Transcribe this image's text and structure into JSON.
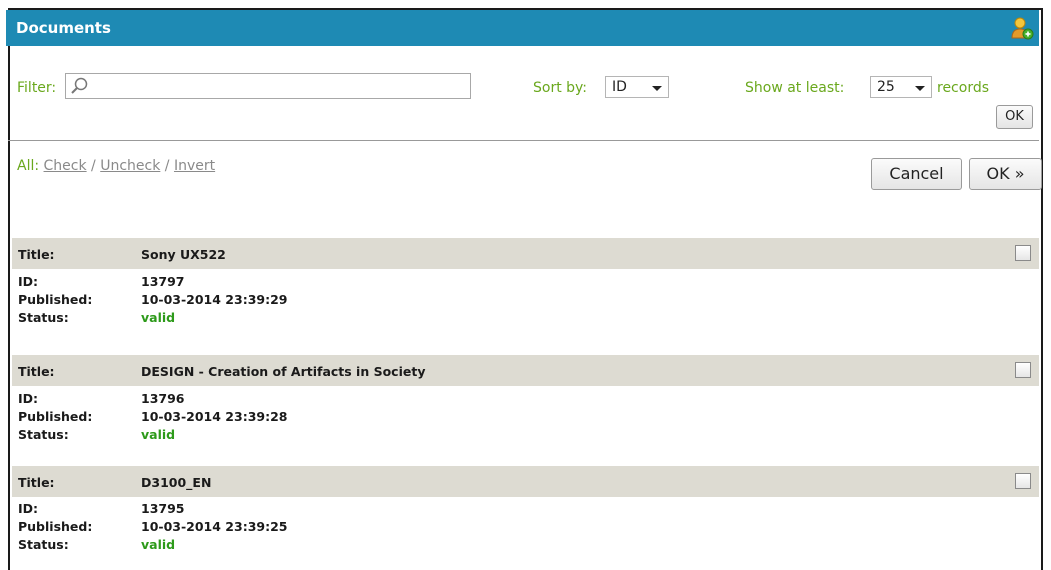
{
  "window": {
    "title": "Documents",
    "icon": "user-add-icon"
  },
  "filter": {
    "label": "Filter:",
    "value": "",
    "placeholder": ""
  },
  "sort": {
    "label": "Sort by:",
    "selected": "ID"
  },
  "show": {
    "label": "Show at least:",
    "selected": "25",
    "suffix": "records"
  },
  "toolbar": {
    "ok_label": "OK"
  },
  "selection": {
    "all_label": "All:",
    "check": "Check",
    "uncheck": "Uncheck",
    "invert": "Invert",
    "sep1": " / ",
    "sep2": " / "
  },
  "actions": {
    "cancel_label": "Cancel",
    "ok_label": "OK »"
  },
  "field_labels": {
    "title": "Title:",
    "id": "ID:",
    "published": "Published:",
    "status": "Status:"
  },
  "documents": [
    {
      "title": "Sony UX522",
      "id": "13797",
      "published": "10-03-2014 23:39:29",
      "status": "valid",
      "checked": false
    },
    {
      "title": "DESIGN - Creation of Artifacts in Society",
      "id": "13796",
      "published": "10-03-2014 23:39:28",
      "status": "valid",
      "checked": false
    },
    {
      "title": "D3100_EN",
      "id": "13795",
      "published": "10-03-2014 23:39:25",
      "status": "valid",
      "checked": false
    }
  ],
  "colors": {
    "header_bg": "#1e8ab4",
    "label_green": "#6aa81d",
    "status_valid": "#2d9a1a",
    "row_header_bg": "#dddbd2"
  }
}
